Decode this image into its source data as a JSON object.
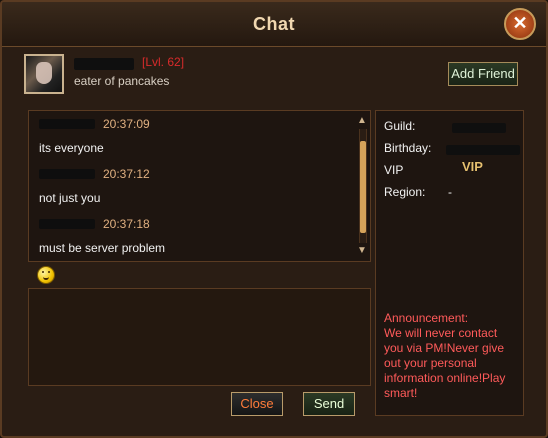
{
  "window": {
    "title": "Chat",
    "close_icon": "✕"
  },
  "profile": {
    "level": "[Lvl. 62]",
    "status": "eater of pancakes",
    "add_friend_label": "Add Friend"
  },
  "chat": {
    "messages": [
      {
        "time": "20:37:09",
        "text": "its everyone"
      },
      {
        "time": "20:37:12",
        "text": "not just you"
      },
      {
        "time": "20:37:18",
        "text": "must be server problem"
      }
    ],
    "scroll_up_icon": "▲",
    "scroll_down_icon": "▼"
  },
  "input": {
    "value": "",
    "placeholder": ""
  },
  "buttons": {
    "close_label": "Close",
    "send_label": "Send"
  },
  "info": {
    "guild_label": "Guild:",
    "birthday_label": "Birthday:",
    "vip_label": "VIP",
    "vip_badge": "VIP",
    "region_label": "Region:",
    "region_value": "-",
    "announcement": "Announcement:\nWe will never contact you via PM!Never give out your personal information online!Play smart!"
  },
  "colors": {
    "accent_red": "#d92b2b",
    "timestamp": "#e0b080",
    "announcement": "#ff5a5a"
  }
}
